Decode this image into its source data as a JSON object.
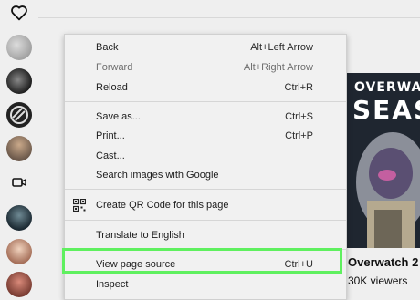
{
  "context_menu": {
    "back": {
      "label": "Back",
      "shortcut": "Alt+Left Arrow"
    },
    "forward": {
      "label": "Forward",
      "shortcut": "Alt+Right Arrow"
    },
    "reload": {
      "label": "Reload",
      "shortcut": "Ctrl+R"
    },
    "save_as": {
      "label": "Save as...",
      "shortcut": "Ctrl+S"
    },
    "print": {
      "label": "Print...",
      "shortcut": "Ctrl+P"
    },
    "cast": {
      "label": "Cast..."
    },
    "search_images": {
      "label": "Search images with Google"
    },
    "qr_code": {
      "label": "Create QR Code for this page",
      "icon": "qr-code-icon"
    },
    "translate": {
      "label": "Translate to English"
    },
    "view_source": {
      "label": "View page source",
      "shortcut": "Ctrl+U"
    },
    "inspect": {
      "label": "Inspect"
    }
  },
  "sidebar": {
    "icons": [
      "heart-icon",
      "video-camera-icon"
    ],
    "avatars": 8
  },
  "stream": {
    "thumbnail_title_line1": "OVERWAT",
    "thumbnail_title_line2": "SEAS",
    "name": "Overwatch 2",
    "viewers": "30K viewers"
  },
  "colors": {
    "highlight_border": "#5ff05f",
    "menu_background": "#f1f1f1"
  }
}
